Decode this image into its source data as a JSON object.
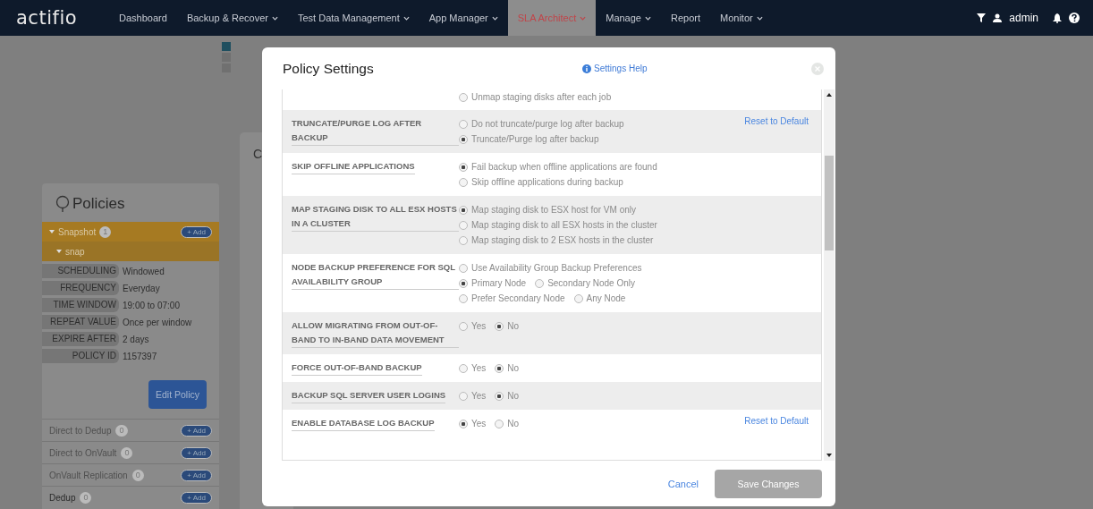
{
  "nav": {
    "logo": "actifio",
    "items": [
      {
        "label": "Dashboard",
        "dropdown": false,
        "selected": false
      },
      {
        "label": "Backup & Recover",
        "dropdown": true,
        "selected": false
      },
      {
        "label": "Test Data Management",
        "dropdown": true,
        "selected": false
      },
      {
        "label": "App Manager",
        "dropdown": true,
        "selected": false
      },
      {
        "label": "SLA Architect",
        "dropdown": true,
        "selected": true
      },
      {
        "label": "Manage",
        "dropdown": true,
        "selected": false
      },
      {
        "label": "Report",
        "dropdown": false,
        "selected": false
      },
      {
        "label": "Monitor",
        "dropdown": true,
        "selected": false
      }
    ],
    "user": "admin"
  },
  "background_card_text": "C",
  "policies": {
    "title": "Policies",
    "snapshot": {
      "label": "Snapshot",
      "count": "1",
      "add": "+ Add",
      "policy": "snap"
    },
    "details": [
      {
        "label": "SCHEDULING",
        "value": "Windowed"
      },
      {
        "label": "FREQUENCY",
        "value": "Everyday"
      },
      {
        "label": "TIME WINDOW",
        "value": "19:00 to 07:00"
      },
      {
        "label": "REPEAT VALUE",
        "value": "Once per window"
      },
      {
        "label": "EXPIRE AFTER",
        "value": "2 days"
      },
      {
        "label": "POLICY ID",
        "value": "1157397"
      }
    ],
    "edit_button": "Edit Policy",
    "templates": [
      {
        "label": "Direct to Dedup",
        "count": "0",
        "add": "+ Add",
        "disabled": true
      },
      {
        "label": "Direct to OnVault",
        "count": "0",
        "add": "+ Add",
        "disabled": true
      },
      {
        "label": "OnVault Replication",
        "count": "0",
        "add": "+ Add",
        "disabled": true
      },
      {
        "label": "Dedup",
        "count": "0",
        "add": "+ Add",
        "disabled": false
      }
    ]
  },
  "modal": {
    "title": "Policy Settings",
    "help": "Settings Help",
    "settings": [
      {
        "lines": [
          [
            {
              "label": "Unmap staging disks after each job",
              "selected": false
            }
          ]
        ]
      },
      {
        "label": "TRUNCATE/PURGE LOG AFTER BACKUP",
        "reset": "Reset to Default",
        "lines": [
          [
            {
              "label": "Do not truncate/purge log after backup",
              "selected": false
            }
          ],
          [
            {
              "label": "Truncate/Purge log after backup",
              "selected": true
            }
          ]
        ]
      },
      {
        "label": "SKIP OFFLINE APPLICATIONS",
        "lines": [
          [
            {
              "label": "Fail backup when offline applications are found",
              "selected": true
            }
          ],
          [
            {
              "label": "Skip offline applications during backup",
              "selected": false
            }
          ]
        ]
      },
      {
        "label": "MAP STAGING DISK TO ALL ESX HOSTS IN A CLUSTER",
        "lines": [
          [
            {
              "label": "Map staging disk to ESX host for VM only",
              "selected": true
            }
          ],
          [
            {
              "label": "Map staging disk to all ESX hosts in the cluster",
              "selected": false
            }
          ],
          [
            {
              "label": "Map staging disk to 2 ESX hosts in the cluster",
              "selected": false
            }
          ]
        ]
      },
      {
        "label": "NODE BACKUP PREFERENCE FOR SQL AVAILABILITY GROUP",
        "lines": [
          [
            {
              "label": "Use Availability Group Backup Preferences",
              "selected": false
            }
          ],
          [
            {
              "label": "Primary Node",
              "selected": true
            },
            {
              "label": "Secondary Node Only",
              "selected": false
            }
          ],
          [
            {
              "label": "Prefer Secondary Node",
              "selected": false
            },
            {
              "label": "Any Node",
              "selected": false
            }
          ]
        ]
      },
      {
        "label": "ALLOW MIGRATING FROM OUT-OF-BAND TO IN-BAND DATA MOVEMENT",
        "lines": [
          [
            {
              "label": "Yes",
              "selected": false
            },
            {
              "label": "No",
              "selected": true
            }
          ]
        ]
      },
      {
        "label": "FORCE OUT-OF-BAND BACKUP",
        "lines": [
          [
            {
              "label": "Yes",
              "selected": false
            },
            {
              "label": "No",
              "selected": true
            }
          ]
        ]
      },
      {
        "label": "BACKUP SQL SERVER USER LOGINS",
        "lines": [
          [
            {
              "label": "Yes",
              "selected": false
            },
            {
              "label": "No",
              "selected": true
            }
          ]
        ]
      },
      {
        "label": "ENABLE DATABASE LOG BACKUP",
        "reset": "Reset to Default",
        "lines": [
          [
            {
              "label": "Yes",
              "selected": true
            },
            {
              "label": "No",
              "selected": false
            }
          ]
        ]
      }
    ],
    "cancel": "Cancel",
    "save": {
      "label": "Save Changes",
      "disabled": true
    }
  }
}
